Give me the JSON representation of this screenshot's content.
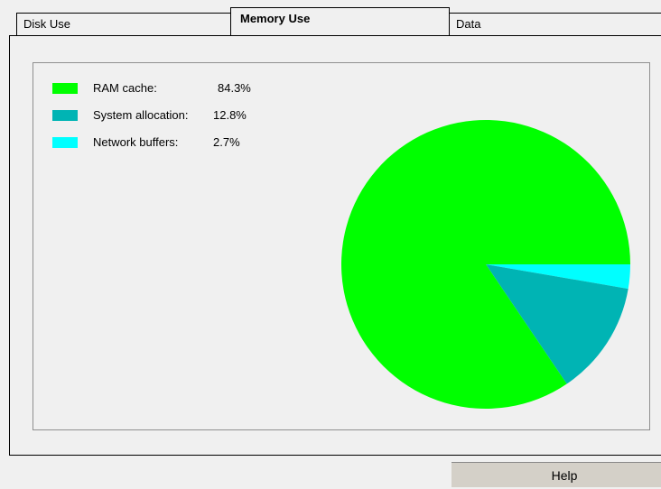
{
  "tabs": [
    {
      "label": "Disk Use"
    },
    {
      "label": "Memory Use"
    },
    {
      "label": "Data"
    }
  ],
  "active_tab": "Memory Use",
  "chart_data": {
    "type": "pie",
    "categories": [
      "RAM cache:",
      "System allocation:",
      "Network buffers:"
    ],
    "values": [
      84.3,
      12.8,
      2.7
    ],
    "value_labels": [
      "84.3%",
      "12.8%",
      "2.7%"
    ],
    "colors": [
      "#00ff00",
      "#00b4b4",
      "#00ffff"
    ],
    "legend_position": "top-left"
  },
  "help_button": {
    "label": "Help"
  }
}
